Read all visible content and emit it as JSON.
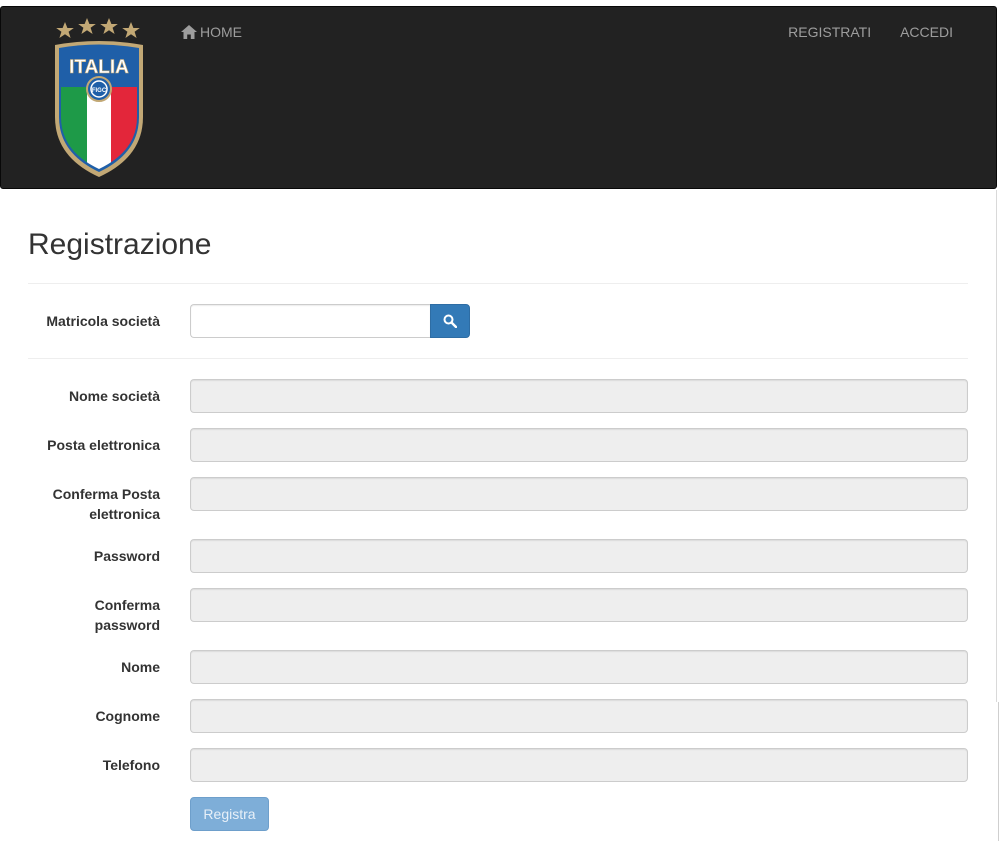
{
  "navbar": {
    "logo_text": "ITALIA",
    "logo_badge": "FIGC",
    "home_label": "HOME",
    "register_label": "REGISTRATI",
    "login_label": "ACCEDI"
  },
  "page": {
    "title": "Registrazione"
  },
  "form": {
    "matricola_label": "Matricola società",
    "matricola_value": "",
    "fields": [
      {
        "label": "Nome società",
        "value": ""
      },
      {
        "label": "Posta elettronica",
        "value": ""
      },
      {
        "label": "Conferma Posta elettronica",
        "value": ""
      },
      {
        "label": "Password",
        "value": ""
      },
      {
        "label": "Conferma password",
        "value": ""
      },
      {
        "label": "Nome",
        "value": ""
      },
      {
        "label": "Cognome",
        "value": ""
      },
      {
        "label": "Telefono",
        "value": ""
      }
    ],
    "submit_label": "Registra"
  },
  "colors": {
    "navbar_bg": "#222222",
    "nav_text": "#9d9d9d",
    "primary": "#337ab7",
    "primary_disabled": "#7eaed8",
    "disabled_field": "#eeeeee",
    "logo_gold": "#c2a875",
    "logo_blue": "#1f5fa8",
    "flag_green": "#1e9a48",
    "flag_red": "#e3263a"
  },
  "icons": {
    "home": "home-icon",
    "search": "search-icon",
    "stars": "star-icon"
  }
}
